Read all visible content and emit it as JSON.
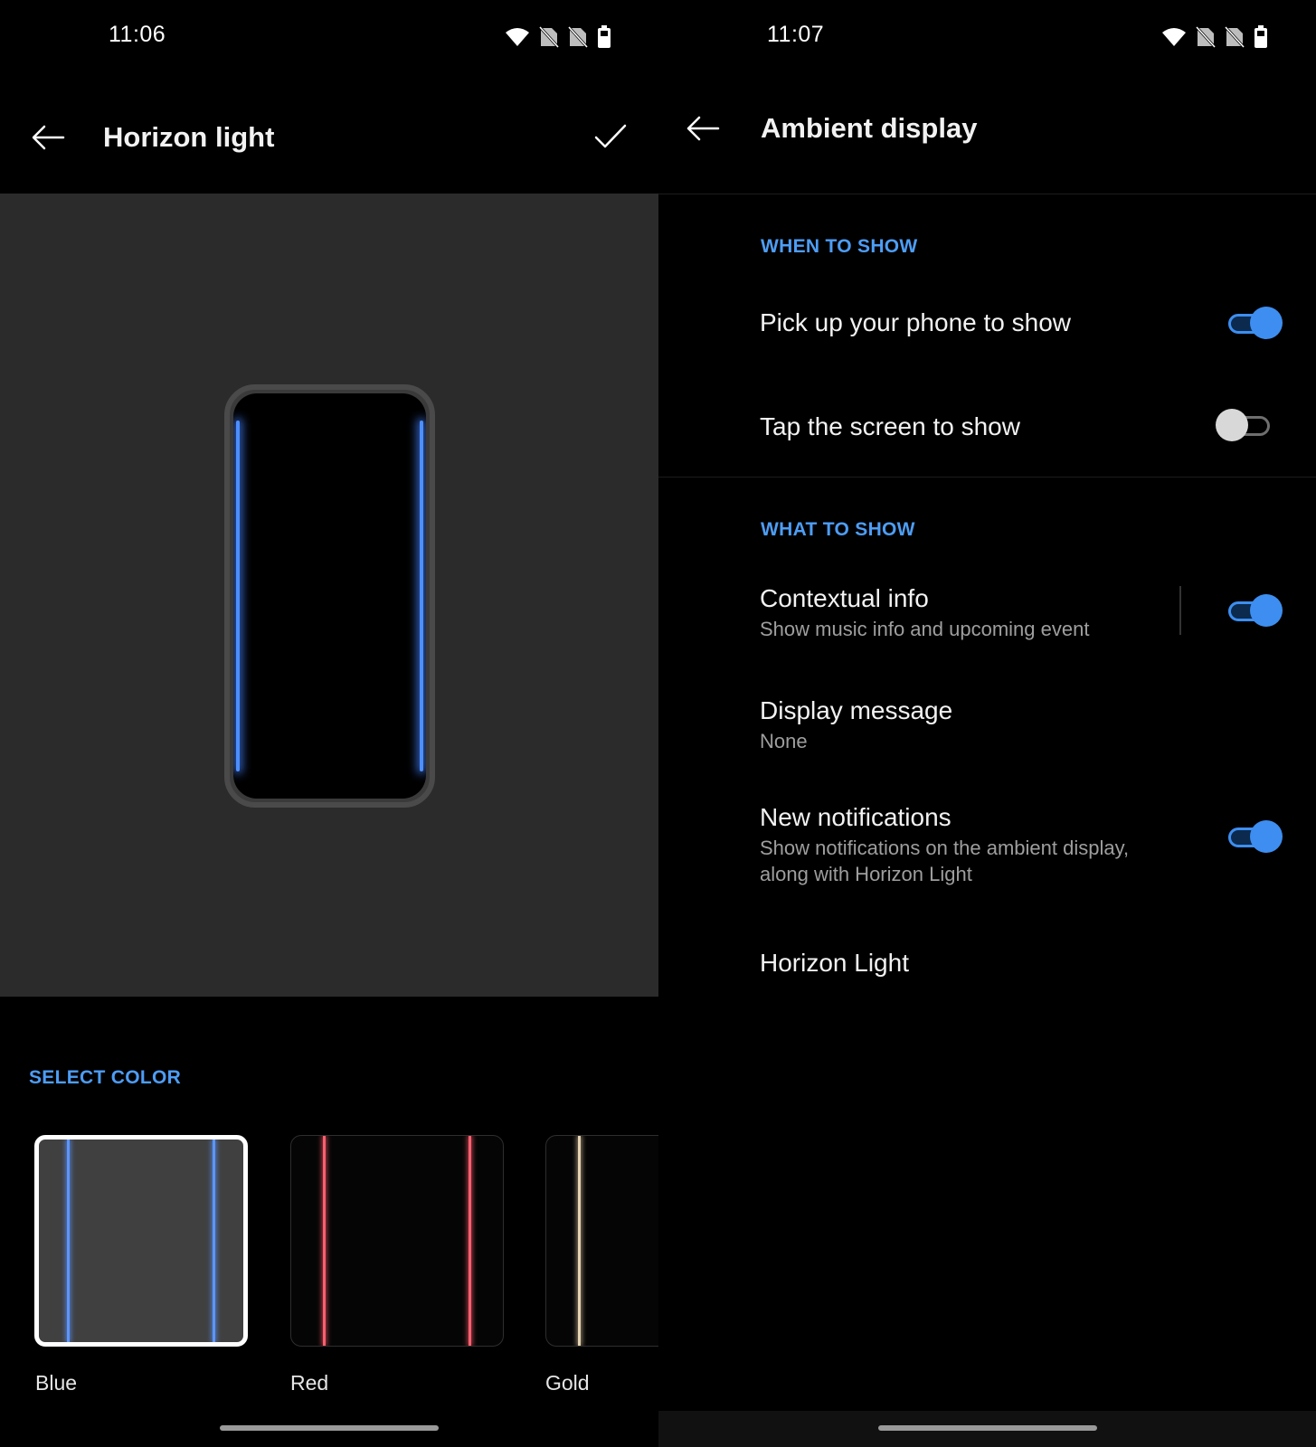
{
  "left_screen": {
    "status": {
      "time": "11:06"
    },
    "app_bar": {
      "title": "Horizon light"
    },
    "preview": {
      "glow_color": "#4d8fff"
    },
    "select_color": {
      "header": "SELECT COLOR",
      "options": [
        {
          "label": "Blue",
          "color": "#5c95ff",
          "selected": true
        },
        {
          "label": "Red",
          "color": "#ff5f6e",
          "selected": false
        },
        {
          "label": "Gold",
          "color": "#e6d2b0",
          "selected": false
        }
      ]
    }
  },
  "right_screen": {
    "status": {
      "time": "11:07"
    },
    "app_bar": {
      "title": "Ambient display"
    },
    "when_to_show": {
      "header": "WHEN TO SHOW",
      "items": [
        {
          "title": "Pick up your phone to show",
          "enabled": true
        },
        {
          "title": "Tap the screen to show",
          "enabled": false
        }
      ]
    },
    "what_to_show": {
      "header": "WHAT TO SHOW",
      "contextual_info": {
        "title": "Contextual info",
        "summary": "Show music info and upcoming event",
        "enabled": true
      },
      "display_message": {
        "title": "Display message",
        "summary": "None"
      },
      "new_notifications": {
        "title": "New notifications",
        "summary": "Show notifications on the ambient display, along with Horizon Light",
        "enabled": true
      },
      "horizon_light": {
        "title": "Horizon Light"
      }
    }
  },
  "theme": {
    "accent": "#3d8ef0",
    "section_header": "#4d9df5",
    "background": "#000000",
    "preview_bg": "#2b2b2b"
  }
}
